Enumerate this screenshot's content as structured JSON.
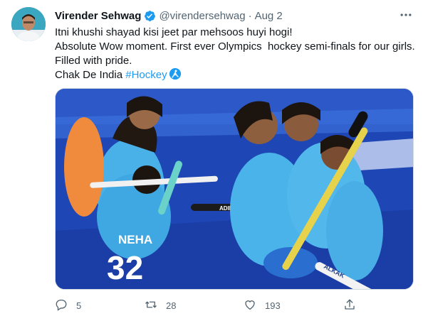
{
  "author": {
    "display_name": "Virender Sehwag",
    "verified": true,
    "handle": "@virendersehwag",
    "separator": "·",
    "date": "Aug 2"
  },
  "tweet": {
    "lines": [
      "Itni khushi shayad kisi jeet par mehsoos huyi hogi!",
      "Absolute Wow moment. First ever Olympics  hockey semi-finals for our girls.",
      "Filled with pride."
    ],
    "last_line_text": "Chak De India ",
    "hashtag": "#Hockey"
  },
  "media": {
    "jersey_name": "NEHA",
    "jersey_number": "32",
    "stick_brand": "ADIDAS",
    "stick_text": "ALKAK"
  },
  "actions": {
    "reply_count": "5",
    "retweet_count": "28",
    "like_count": "193"
  },
  "icons": {
    "more": "more-horizontal-icon",
    "verified": "verified-badge-icon",
    "reply": "reply-icon",
    "retweet": "retweet-icon",
    "like": "heart-icon",
    "share": "share-icon",
    "hashflag": "hockey-hashflag-icon"
  },
  "colors": {
    "accent": "#1d9bf0",
    "muted": "#536471",
    "text": "#0f1419"
  }
}
